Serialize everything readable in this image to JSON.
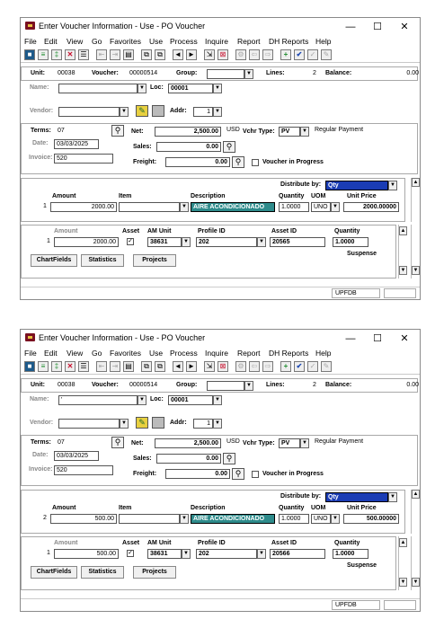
{
  "windows": [
    {
      "title": "Enter Voucher Information - Use - PO Voucher",
      "minimize": "—",
      "maximize": "☐",
      "close": "✕",
      "menu": [
        "File",
        "Edit",
        "View",
        "Go",
        "Favorites",
        "Use",
        "Process",
        "Inquire",
        "Report",
        "DH Reports",
        "Help"
      ],
      "header": {
        "unit_label": "Unit:",
        "unit": "00038",
        "voucher_label": "Voucher:",
        "voucher": "00000514",
        "group_label": "Group:",
        "group": "",
        "lines_label": "Lines:",
        "lines": "2",
        "balance_label": "Balance:",
        "balance": "0.00"
      },
      "vendor": {
        "name_label": "Name:",
        "name": "",
        "loc_label": "Loc:",
        "loc": "00001",
        "vendor_label": "Vendor:",
        "vendor": "",
        "addr_label": "Addr:",
        "addr": "1"
      },
      "terms": {
        "terms_label": "Terms:",
        "terms": "07",
        "net_label": "Net:",
        "net": "2,500.00",
        "currency": "USD",
        "type_label": "Vchr Type:",
        "type": "PV",
        "type_desc": "Regular Payment",
        "date_label": "Date:",
        "date": "03/03/2025",
        "sales_label": "Sales:",
        "sales": "0.00",
        "invoice_label": "Invoice:",
        "invoice": "520",
        "freight_label": "Freight:",
        "freight": "0.00",
        "progress_label": "Voucher in Progress"
      },
      "line": {
        "dist_label": "Distribute by:",
        "dist": "Qty",
        "amount_label": "Amount",
        "item_label": "Item",
        "desc_label": "Description",
        "qty_label": "Quantity",
        "uom_label": "UOM",
        "price_label": "Unit Price",
        "line_no": "1",
        "amount": "2000.00",
        "item": "",
        "desc": "AIRE ACONDICIONADO",
        "qty": "1.0000",
        "uom": "UNO",
        "price": "2000.00000"
      },
      "dist": {
        "amount_label": "Amount",
        "asset_label": "Asset",
        "am_unit_label": "AM Unit",
        "profile_label": "Profile ID",
        "asset_id_label": "Asset ID",
        "qty_label": "Quantity",
        "row_no": "1",
        "amount": "2000.00",
        "am_unit": "38631",
        "profile": "202",
        "asset_id": "20565",
        "qty": "1.0000",
        "suspense": "Suspense",
        "btn_chartfields": "ChartFields",
        "btn_statistics": "Statistics",
        "btn_projects": "Projects"
      },
      "status": {
        "server": "UPFDB"
      }
    },
    {
      "title": "Enter Voucher Information - Use - PO Voucher",
      "minimize": "—",
      "maximize": "☐",
      "close": "✕",
      "menu": [
        "File",
        "Edit",
        "View",
        "Go",
        "Favorites",
        "Use",
        "Process",
        "Inquire",
        "Report",
        "DH Reports",
        "Help"
      ],
      "header": {
        "unit_label": "Unit:",
        "unit": "00038",
        "voucher_label": "Voucher:",
        "voucher": "00000514",
        "group_label": "Group:",
        "group": "",
        "lines_label": "Lines:",
        "lines": "2",
        "balance_label": "Balance:",
        "balance": "0.00"
      },
      "vendor": {
        "name_label": "Name:",
        "name": "'",
        "loc_label": "Loc:",
        "loc": "00001",
        "vendor_label": "Vendor:",
        "vendor": "",
        "addr_label": "Addr:",
        "addr": "1"
      },
      "terms": {
        "terms_label": "Terms:",
        "terms": "07",
        "net_label": "Net:",
        "net": "2,500.00",
        "currency": "USD",
        "type_label": "Vchr Type:",
        "type": "PV",
        "type_desc": "Regular Payment",
        "date_label": "Date:",
        "date": "03/03/2025",
        "sales_label": "Sales:",
        "sales": "0.00",
        "invoice_label": "Invoice:",
        "invoice": "520",
        "freight_label": "Freight:",
        "freight": "0.00",
        "progress_label": "Voucher in Progress"
      },
      "line": {
        "dist_label": "Distribute by:",
        "dist": "Qty",
        "amount_label": "Amount",
        "item_label": "Item",
        "desc_label": "Description",
        "qty_label": "Quantity",
        "uom_label": "UOM",
        "price_label": "Unit Price",
        "line_no": "2",
        "amount": "500.00",
        "item": "",
        "desc": "AIRE ACONDICIONADO",
        "qty": "1.0000",
        "uom": "UNO",
        "price": "500.00000"
      },
      "dist": {
        "amount_label": "Amount",
        "asset_label": "Asset",
        "am_unit_label": "AM Unit",
        "profile_label": "Profile ID",
        "asset_id_label": "Asset ID",
        "qty_label": "Quantity",
        "row_no": "1",
        "amount": "500.00",
        "am_unit": "38631",
        "profile": "202",
        "asset_id": "20566",
        "qty": "1.0000",
        "suspense": "Suspense",
        "btn_chartfields": "ChartFields",
        "btn_statistics": "Statistics",
        "btn_projects": "Projects"
      },
      "status": {
        "server": "UPFDB"
      }
    }
  ],
  "colors": {
    "desc_bg": "#2e8b8b",
    "dist_bg": "#1a3cb4",
    "save_btn": "#1d5a8a",
    "delete_btn": "#c8102e",
    "add_btn": "#1e8c2e",
    "ok_btn": "#1e4ab4"
  }
}
